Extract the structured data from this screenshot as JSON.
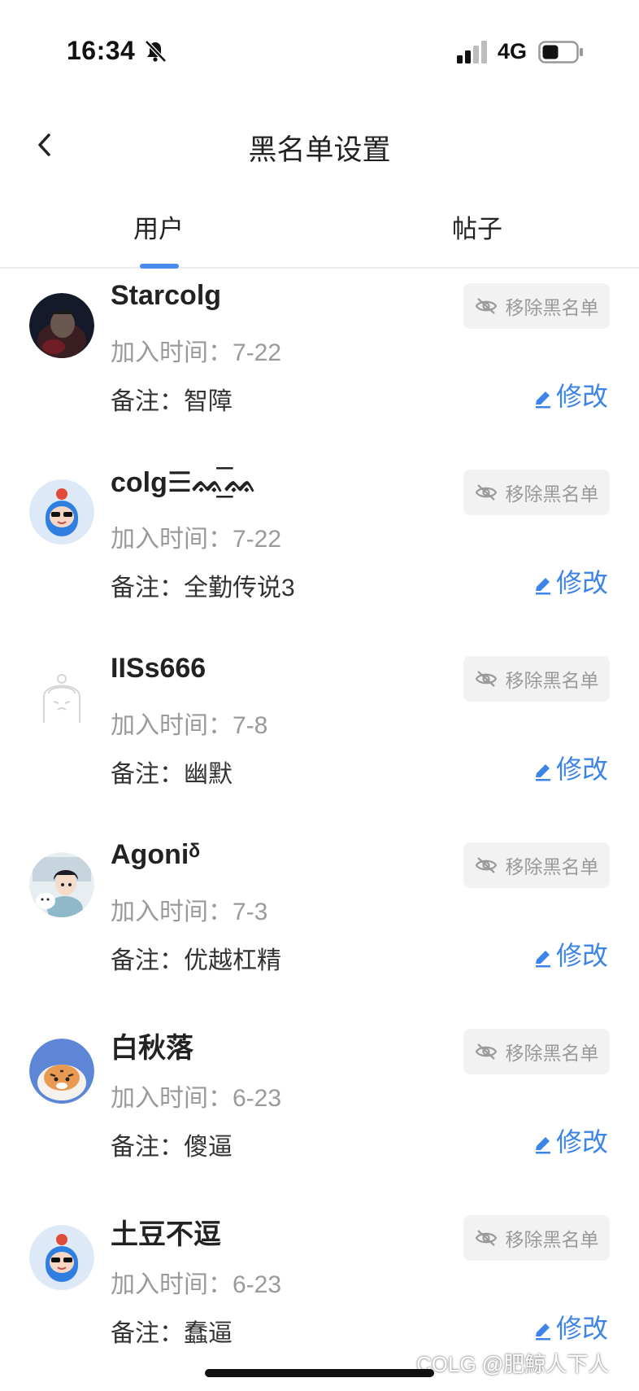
{
  "status_bar": {
    "time": "16:34",
    "network": "4G"
  },
  "nav": {
    "title": "黑名单设置"
  },
  "tabs": [
    {
      "label": "用户",
      "active": true
    },
    {
      "label": "帖子",
      "active": false
    }
  ],
  "colors": {
    "accent": "#3d84e8",
    "tab_indicator": "#4a8cf0",
    "muted_text": "#9a9a9a",
    "button_bg": "#f2f2f2"
  },
  "users": [
    {
      "name": "Starcolg",
      "join_time": "加入时间：7-22",
      "note": "备注：智障",
      "remove_label": "移除黑名单",
      "edit_label": "修改",
      "avatar": "dark-photo-avatar"
    },
    {
      "name": "colg☰ᨐ͟͞ᨐ",
      "join_time": "加入时间：7-22",
      "note": "备注：全勤传说3",
      "remove_label": "移除黑名单",
      "edit_label": "修改",
      "avatar": "blue-mascot-avatar"
    },
    {
      "name": "IISs666",
      "join_time": "加入时间：7-8",
      "note": "备注：幽默",
      "remove_label": "移除黑名单",
      "edit_label": "修改",
      "avatar": "outline-default-avatar"
    },
    {
      "name": "Agoniᵟ",
      "join_time": "加入时间：7-3",
      "note": "备注：优越杠精",
      "remove_label": "移除黑名单",
      "edit_label": "修改",
      "avatar": "cartoon-boy-avatar"
    },
    {
      "name": "白秋落",
      "join_time": "加入时间：6-23",
      "note": "备注：傻逼",
      "remove_label": "移除黑名单",
      "edit_label": "修改",
      "avatar": "tiger-avatar"
    },
    {
      "name": "土豆不逗",
      "join_time": "加入时间：6-23",
      "note": "备注：蠢逼",
      "remove_label": "移除黑名单",
      "edit_label": "修改",
      "avatar": "blue-mascot-avatar"
    }
  ],
  "watermark": "COLG @肥鯨人下人"
}
